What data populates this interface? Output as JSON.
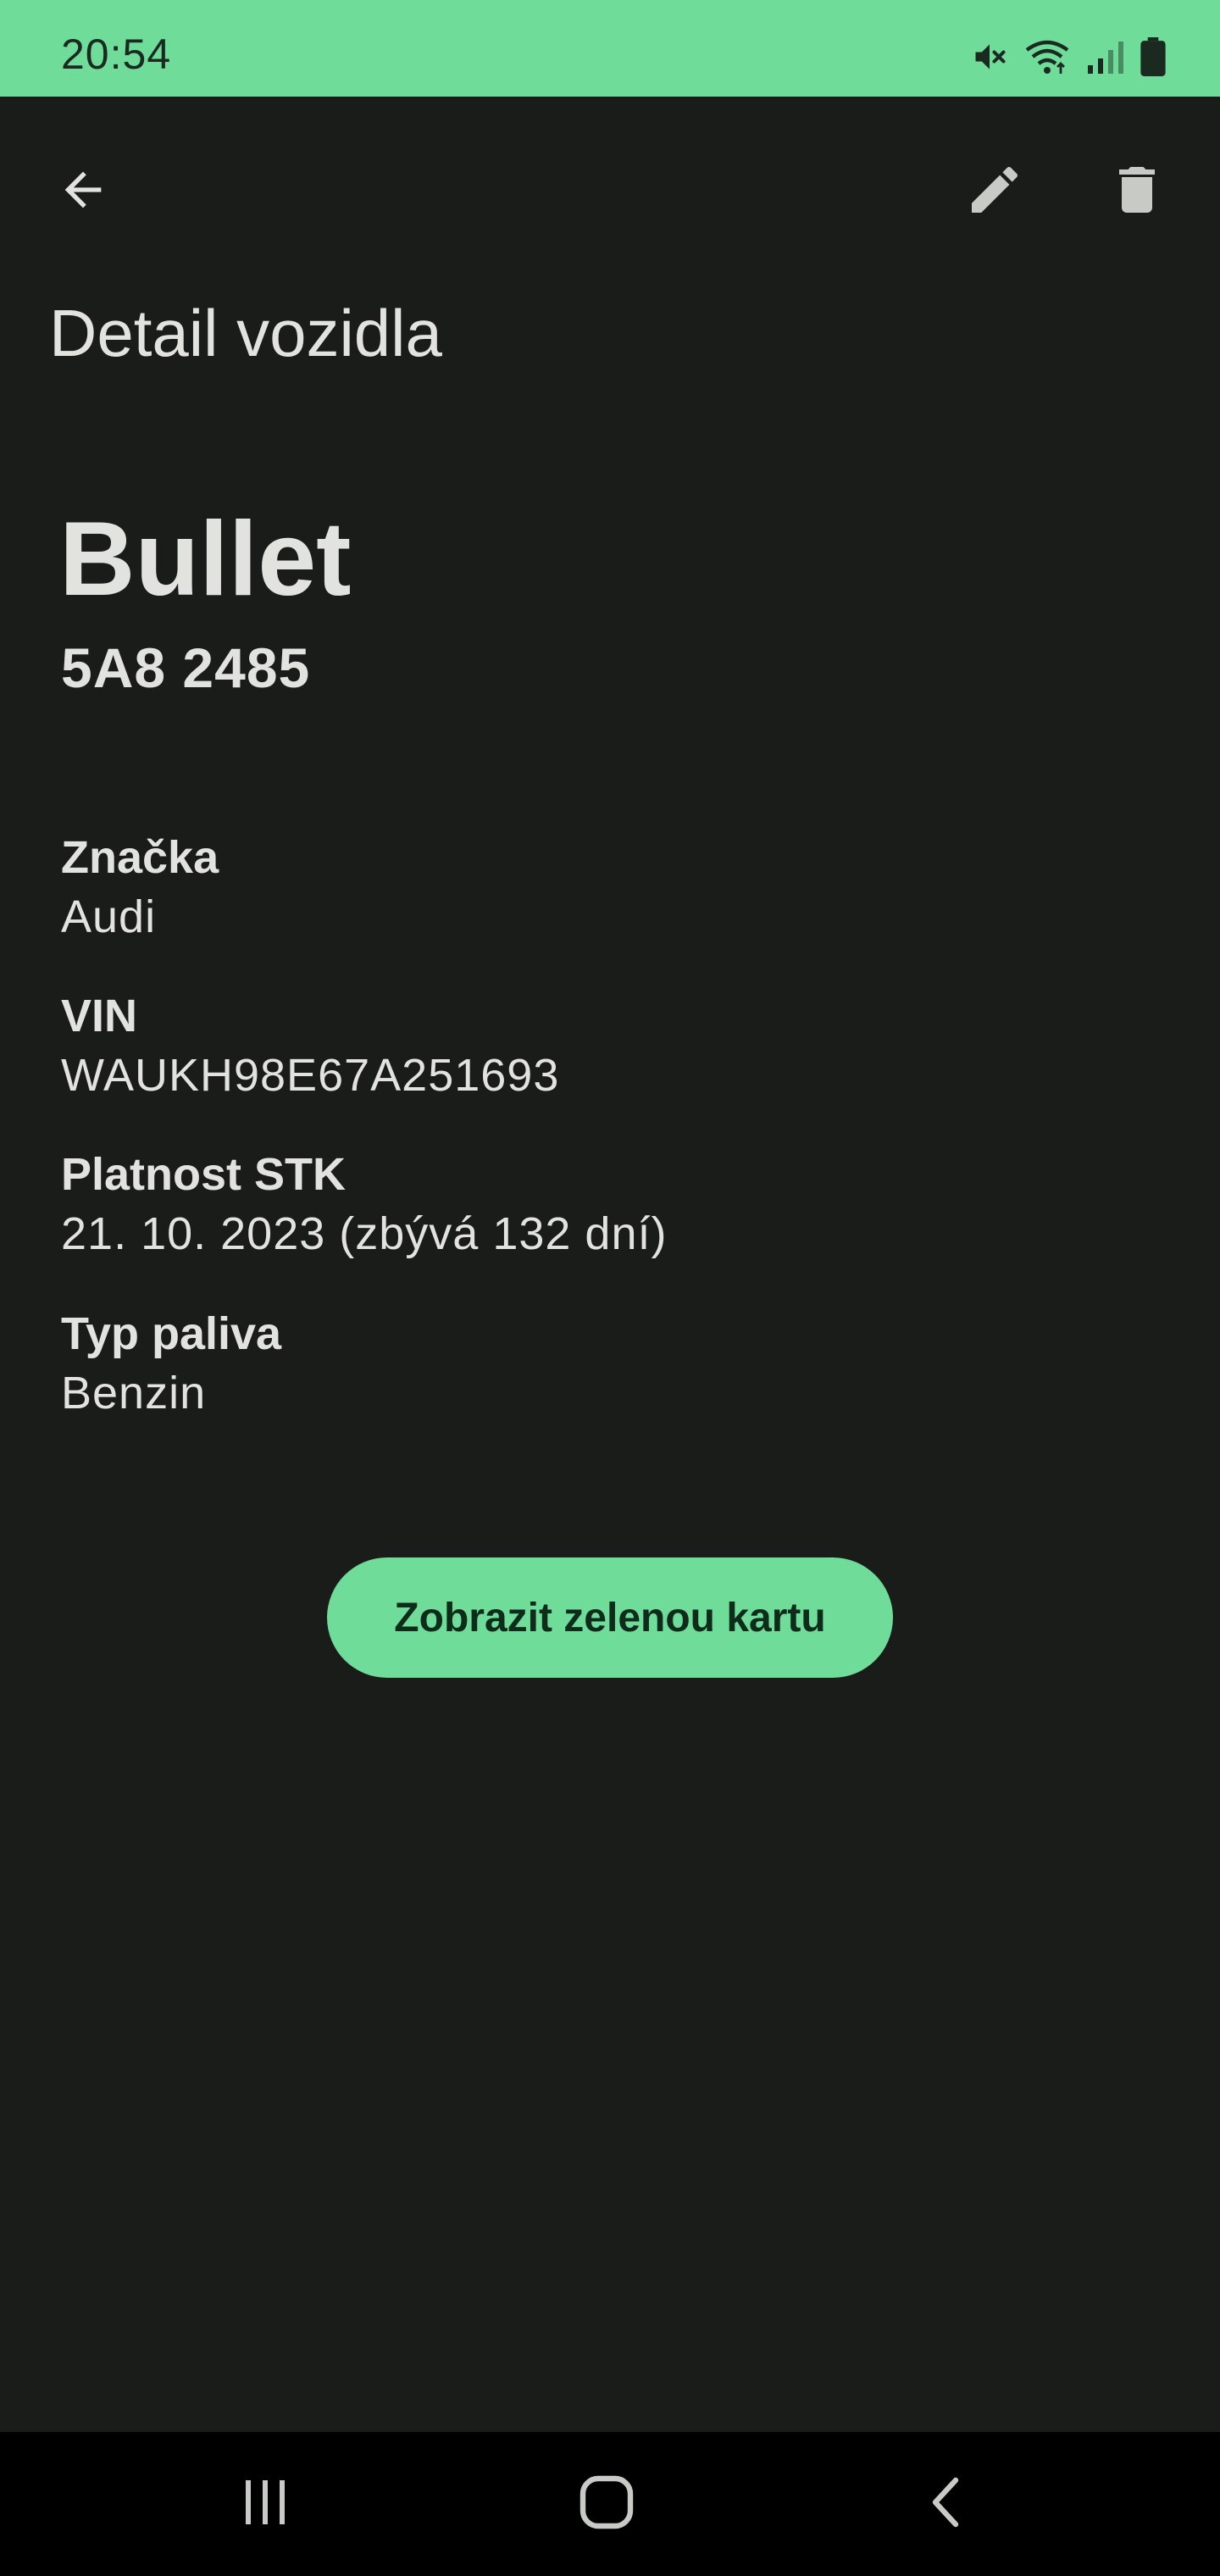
{
  "status_bar": {
    "time": "20:54",
    "icons": [
      "mute-icon",
      "wifi-icon",
      "signal-icon",
      "battery-icon"
    ],
    "background": "#6fdc9a"
  },
  "app_bar": {
    "back_icon": "arrow-back-icon",
    "edit_icon": "pencil-icon",
    "delete_icon": "trash-icon"
  },
  "page": {
    "title": "Detail vozidla"
  },
  "vehicle": {
    "name": "Bullet",
    "plate": "5A8 2485"
  },
  "details": [
    {
      "label": "Značka",
      "value": "Audi"
    },
    {
      "label": "VIN",
      "value": "WAUKH98E67A251693"
    },
    {
      "label": "Platnost STK",
      "value": "21. 10. 2023 (zbývá 132 dní)"
    },
    {
      "label": "Typ paliva",
      "value": "Benzin"
    }
  ],
  "actions": {
    "green_card_label": "Zobrazit zelenou kartu"
  },
  "nav_bar": {
    "recents_icon": "recents-icon",
    "home_icon": "home-icon",
    "back_icon": "nav-back-icon"
  },
  "colors": {
    "accent": "#6fdc9a",
    "background": "#1a1c1a",
    "text": "#e2e3df"
  }
}
